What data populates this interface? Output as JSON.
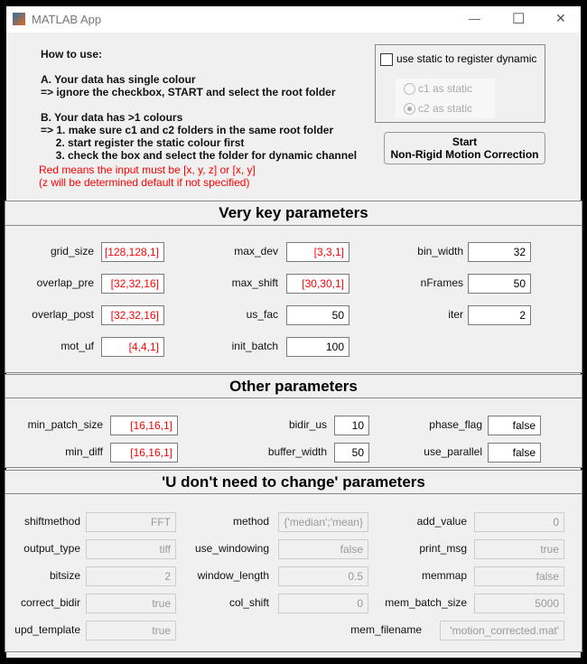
{
  "window": {
    "title": "MATLAB App",
    "minimize": "—",
    "maximize": "☐",
    "close": "✕"
  },
  "help": {
    "lines": [
      "How to use:",
      "",
      "A. Your data has single colour",
      "=> ignore the checkbox, START and select the root folder",
      "",
      "B. Your data has >1 colours",
      "=> 1. make sure c1 and c2 folders in the same root folder",
      "     2. start register the static colour first",
      "     3. check the box and select the folder for dynamic channel"
    ],
    "red_lines": [
      "Red means the input must be [x, y, z] or [x, y]",
      "(z will be determined default if not specified)"
    ]
  },
  "static_panel": {
    "checkbox_label": "use static to register dynamic",
    "checked": false,
    "radios": [
      {
        "label": "c1 as static",
        "selected": false
      },
      {
        "label": "c2 as static",
        "selected": true
      }
    ]
  },
  "start_button": {
    "line1": "Start",
    "line2": "Non-Rigid Motion Correction"
  },
  "key_params": {
    "title": "Very key parameters",
    "fields": [
      {
        "label": "grid_size",
        "value": "[128,128,1]",
        "red": true
      },
      {
        "label": "max_dev",
        "value": "[3,3,1]",
        "red": true
      },
      {
        "label": "bin_width",
        "value": "32",
        "red": false
      },
      {
        "label": "overlap_pre",
        "value": "[32,32,16]",
        "red": true
      },
      {
        "label": "max_shift",
        "value": "[30,30,1]",
        "red": true
      },
      {
        "label": "nFrames",
        "value": "50",
        "red": false
      },
      {
        "label": "overlap_post",
        "value": "[32,32,16]",
        "red": true
      },
      {
        "label": "us_fac",
        "value": "50",
        "red": false
      },
      {
        "label": "iter",
        "value": "2",
        "red": false
      },
      {
        "label": "mot_uf",
        "value": "[4,4,1]",
        "red": true
      },
      {
        "label": "init_batch",
        "value": "100",
        "red": false
      }
    ]
  },
  "other_params": {
    "title": "Other parameters",
    "fields": [
      {
        "label": "min_patch_size",
        "value": "[16,16,1]",
        "red": true
      },
      {
        "label": "bidir_us",
        "value": "10",
        "red": false
      },
      {
        "label": "phase_flag",
        "value": "false",
        "red": false
      },
      {
        "label": "min_diff",
        "value": "[16,16,1]",
        "red": true
      },
      {
        "label": "buffer_width",
        "value": "50",
        "red": false
      },
      {
        "label": "use_parallel",
        "value": "false",
        "red": false
      }
    ]
  },
  "fixed_params": {
    "title": "'U don't need to change' parameters",
    "fields": [
      {
        "label": "shiftmethod",
        "value": "FFT"
      },
      {
        "label": "method",
        "value": "{'median';'mean}"
      },
      {
        "label": "add_value",
        "value": "0"
      },
      {
        "label": "output_type",
        "value": "tiff"
      },
      {
        "label": "use_windowing",
        "value": "false"
      },
      {
        "label": "print_msg",
        "value": "true"
      },
      {
        "label": "bitsize",
        "value": "2"
      },
      {
        "label": "window_length",
        "value": "0.5"
      },
      {
        "label": "memmap",
        "value": "false"
      },
      {
        "label": "correct_bidir",
        "value": "true"
      },
      {
        "label": "col_shift",
        "value": "0"
      },
      {
        "label": "mem_batch_size",
        "value": "5000"
      },
      {
        "label": "upd_template",
        "value": "true"
      },
      {
        "label": "mem_filename",
        "value": "'motion_corrected.mat'"
      }
    ]
  }
}
